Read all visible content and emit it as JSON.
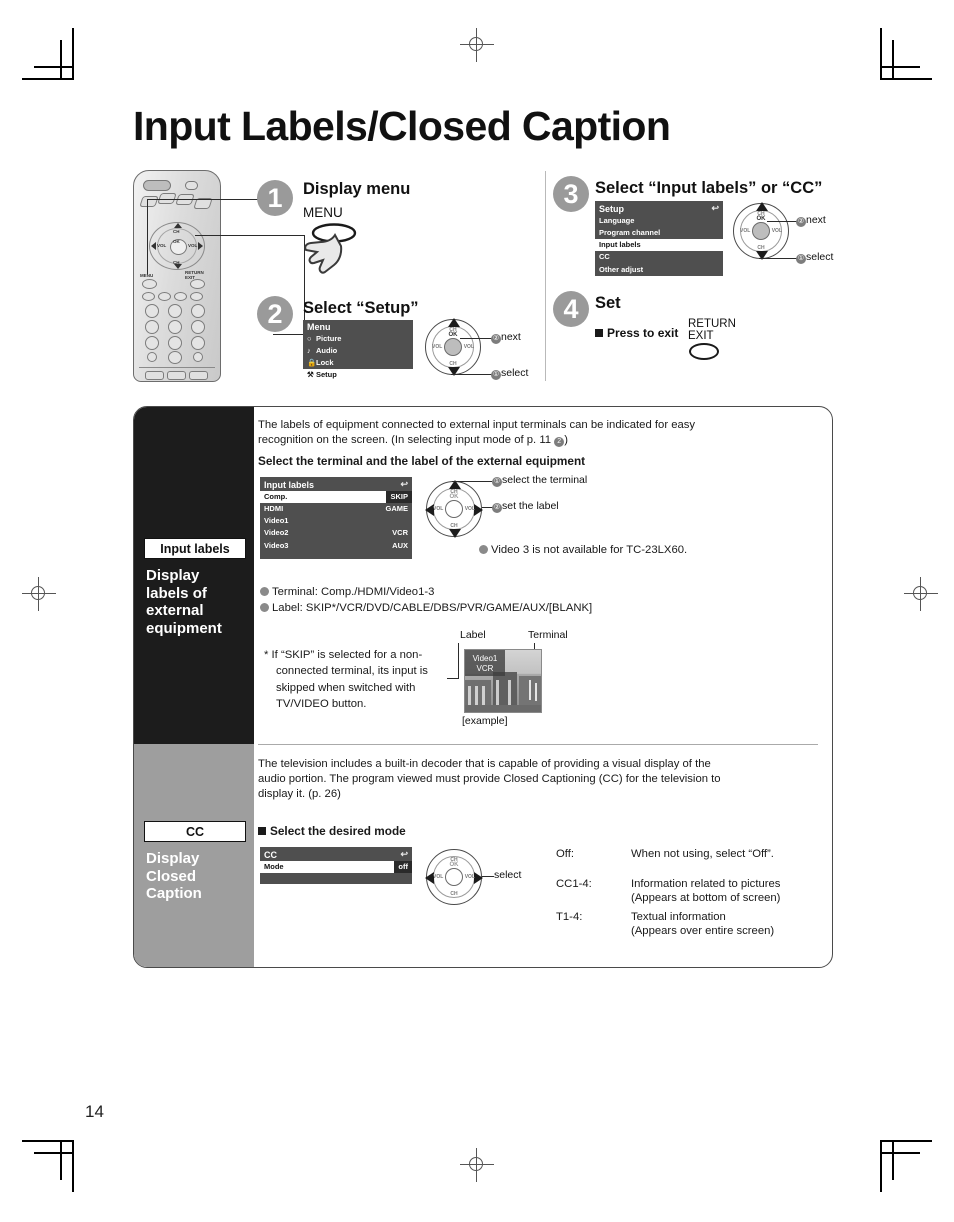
{
  "page": {
    "title": "Input Labels/Closed Caption",
    "number": "14"
  },
  "steps": [
    {
      "num": "1",
      "title": "Display menu",
      "button_label": "MENU"
    },
    {
      "num": "2",
      "title": "Select “Setup”",
      "osd": {
        "header": "Menu",
        "back_icon": "",
        "rows": [
          {
            "icon": "○",
            "label": "Picture",
            "selected": false
          },
          {
            "icon": "♪",
            "label": "Audio",
            "selected": false
          },
          {
            "icon": "ὑ2",
            "label": "Lock",
            "selected": false
          },
          {
            "icon": "⑃",
            "label": "Setup",
            "selected": true
          }
        ]
      },
      "callouts": [
        {
          "num": "②",
          "text": "next"
        },
        {
          "num": "①",
          "text": "select"
        }
      ]
    },
    {
      "num": "3",
      "title": "Select “Input labels” or “CC”",
      "osd": {
        "header": "Setup",
        "back_icon": "↩",
        "rows": [
          {
            "label": "Language",
            "selected": false
          },
          {
            "label": "Program channel",
            "selected": false
          },
          {
            "label": "Input labels",
            "selected": true
          },
          {
            "label": "CC",
            "selected": false
          },
          {
            "label": "Other adjust",
            "selected": false
          }
        ]
      },
      "callouts": [
        {
          "num": "②",
          "text": "next"
        },
        {
          "num": "①",
          "text": "select"
        }
      ]
    },
    {
      "num": "4",
      "title": "Set",
      "exit_note": "Press to exit",
      "exit_button_line1": "RETURN",
      "exit_button_line2": "EXIT"
    }
  ],
  "section_input_labels": {
    "tag": "Input labels",
    "heading": "Display labels of external equipment",
    "intro_line1": "The labels of equipment connected to external input terminals can be indicated for easy",
    "intro_line2_a": "recognition on the screen. (In selecting input mode of p. 11 ",
    "intro_line2_marker": "2",
    "intro_line2_b": ")",
    "subhead": "Select the terminal and the label of the external equipment",
    "osd": {
      "header": "Input labels",
      "back_icon": "↩",
      "rows": [
        {
          "label": "Comp.",
          "value": "SKIP",
          "selected": true
        },
        {
          "label": "HDMI",
          "value": "GAME",
          "selected": false
        },
        {
          "label": "Video1",
          "value": "",
          "selected": false
        },
        {
          "label": "Video2",
          "value": "VCR",
          "selected": false
        },
        {
          "label": "Video3",
          "value": "AUX",
          "selected": false
        }
      ]
    },
    "callouts": [
      {
        "num": "①",
        "text": "select the terminal"
      },
      {
        "num": "②",
        "text": "set the label"
      }
    ],
    "note_video3": "Video 3 is not available for TC-23LX60.",
    "bullet_terminal": "Terminal:  Comp./HDMI/Video1-3",
    "bullet_label": "Label: SKIP*/VCR/DVD/CABLE/DBS/PVR/GAME/AUX/[BLANK]",
    "footnote": "*  If “SKIP” is selected for a non-connected terminal, its input is skipped when switched with TV/VIDEO button.",
    "example": {
      "label_caption": "Label",
      "terminal_caption": "Terminal",
      "overlay_terminal": "Video1",
      "overlay_label": "VCR",
      "caption": "[example]"
    }
  },
  "section_cc": {
    "tag": "CC",
    "heading": "Display Closed Caption",
    "intro_line1": "The television includes a built-in decoder that is capable of providing a visual display of the",
    "intro_line2": "audio portion. The program viewed must provide Closed Captioning (CC) for the television to",
    "intro_line3": "display it. (p. 26)",
    "subhead": "Select the desired mode",
    "osd": {
      "header": "CC",
      "back_icon": "↩",
      "rows": [
        {
          "label": "Mode",
          "value": "off",
          "selected": true
        }
      ]
    },
    "callout_select": "select",
    "modes": [
      {
        "name": "Off:",
        "desc1": "When not using, select “Off”.",
        "desc2": ""
      },
      {
        "name": "CC1-4:",
        "desc1": "Information related to pictures",
        "desc2": "(Appears at bottom of screen)"
      },
      {
        "name": "T1-4:",
        "desc1": "Textual information",
        "desc2": "(Appears over entire screen)"
      }
    ]
  },
  "pad_marks": {
    "ok": "OK",
    "ch": "CH",
    "vol": "VOL"
  }
}
